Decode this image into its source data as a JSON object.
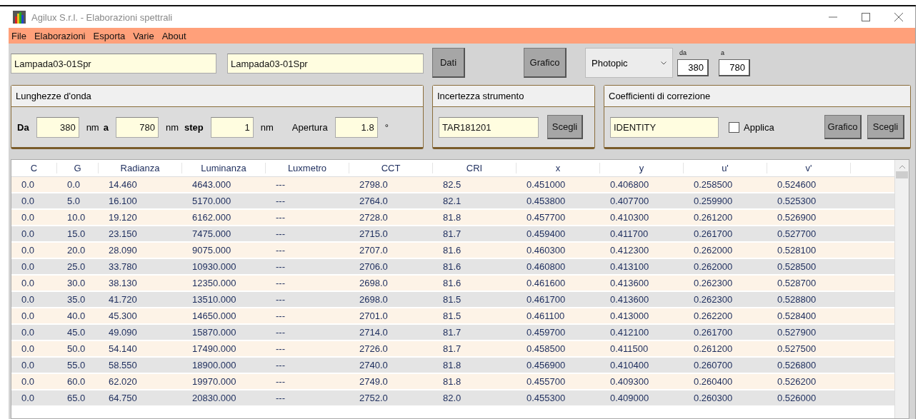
{
  "window": {
    "title": "Agilux S.r.l. - Elaborazioni spettrali"
  },
  "menu": [
    "File",
    "Elaborazioni",
    "Esporta",
    "Varie",
    "About"
  ],
  "toolbar": {
    "file_a": "Lampada03-01Spr",
    "file_b": "Lampada03-01Spr",
    "dati_button": "Dati",
    "grafico_button": "Grafico",
    "curve_select": "Photopic",
    "da_label": "da",
    "da_value": "380",
    "a_label": "a",
    "a_value": "780"
  },
  "wavelengths": {
    "title": "Lunghezze d'onda",
    "da_label": "Da",
    "da_value": "380",
    "unit_1": "nm",
    "a_label": "a",
    "a_value": "780",
    "unit_2": "nm",
    "step_label": "step",
    "step_value": "1",
    "unit_3": "nm",
    "aperture_label": "Apertura",
    "aperture_value": "1.8",
    "aperture_unit": "°"
  },
  "uncertainty": {
    "title": "Incertezza strumento",
    "value": "TAR181201",
    "choose_button": "Scegli"
  },
  "correction": {
    "title": "Coefficienti di correzione",
    "value": "IDENTITY",
    "apply_label": "Applica",
    "apply_checked": false,
    "chart_button": "Grafico",
    "choose_button": "Scegli"
  },
  "table": {
    "columns": [
      "C",
      "G",
      "Radianza",
      "Luminanza",
      "Luxmetro",
      "CCT",
      "CRI",
      "x",
      "y",
      "u'",
      "v'"
    ],
    "rows": [
      [
        "0.0",
        "0.0",
        "14.460",
        "4643.000",
        "---",
        "2798.0",
        "82.5",
        "0.451000",
        "0.406800",
        "0.258500",
        "0.524600"
      ],
      [
        "0.0",
        "5.0",
        "16.100",
        "5170.000",
        "---",
        "2764.0",
        "82.1",
        "0.453800",
        "0.407700",
        "0.259900",
        "0.525300"
      ],
      [
        "0.0",
        "10.0",
        "19.120",
        "6162.000",
        "---",
        "2728.0",
        "81.8",
        "0.457700",
        "0.410300",
        "0.261200",
        "0.526900"
      ],
      [
        "0.0",
        "15.0",
        "23.150",
        "7475.000",
        "---",
        "2715.0",
        "81.7",
        "0.459400",
        "0.411700",
        "0.261700",
        "0.527700"
      ],
      [
        "0.0",
        "20.0",
        "28.090",
        "9075.000",
        "---",
        "2707.0",
        "81.6",
        "0.460300",
        "0.412300",
        "0.262000",
        "0.528100"
      ],
      [
        "0.0",
        "25.0",
        "33.780",
        "10930.000",
        "---",
        "2706.0",
        "81.6",
        "0.460800",
        "0.413100",
        "0.262000",
        "0.528500"
      ],
      [
        "0.0",
        "30.0",
        "38.130",
        "12350.000",
        "---",
        "2698.0",
        "81.6",
        "0.461600",
        "0.413600",
        "0.262300",
        "0.528700"
      ],
      [
        "0.0",
        "35.0",
        "41.720",
        "13510.000",
        "---",
        "2698.0",
        "81.5",
        "0.461700",
        "0.413600",
        "0.262300",
        "0.528800"
      ],
      [
        "0.0",
        "40.0",
        "45.300",
        "14650.000",
        "---",
        "2701.0",
        "81.5",
        "0.461100",
        "0.413000",
        "0.262200",
        "0.528400"
      ],
      [
        "0.0",
        "45.0",
        "49.090",
        "15870.000",
        "---",
        "2714.0",
        "81.7",
        "0.459700",
        "0.412100",
        "0.261700",
        "0.527900"
      ],
      [
        "0.0",
        "50.0",
        "54.140",
        "17490.000",
        "---",
        "2726.0",
        "81.7",
        "0.458500",
        "0.411500",
        "0.261200",
        "0.527500"
      ],
      [
        "0.0",
        "55.0",
        "58.550",
        "18900.000",
        "---",
        "2740.0",
        "81.8",
        "0.456900",
        "0.410400",
        "0.260700",
        "0.526800"
      ],
      [
        "0.0",
        "60.0",
        "62.020",
        "19970.000",
        "---",
        "2749.0",
        "81.8",
        "0.455700",
        "0.409300",
        "0.260400",
        "0.526200"
      ],
      [
        "0.0",
        "65.0",
        "64.750",
        "20830.000",
        "---",
        "2752.0",
        "82.0",
        "0.455300",
        "0.409000",
        "0.260300",
        "0.526000"
      ]
    ]
  }
}
